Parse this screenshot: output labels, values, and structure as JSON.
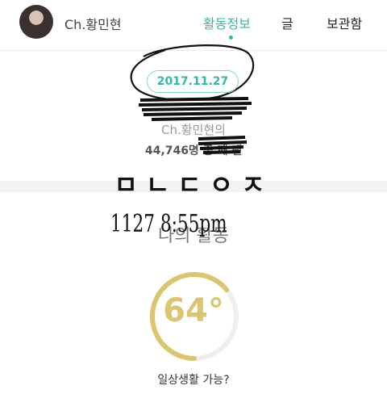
{
  "header": {
    "channel_name": "Ch.황민현",
    "tabs": [
      {
        "label": "활동정보",
        "active": true
      },
      {
        "label": "글",
        "active": false
      },
      {
        "label": "보관함",
        "active": false
      }
    ]
  },
  "profile": {
    "date": "2017.11.27",
    "fan_of": "Ch.황민현의",
    "rank_line": "44,746명 중 째 팬"
  },
  "overlay": {
    "stamp_text": "ㅁㄴㄷㅇㅈ",
    "handwritten_note": "1127 8:55pm"
  },
  "activity": {
    "section_title": "나의 활동",
    "gauge_value": 64,
    "gauge_label": "64°",
    "caption": "일상생활 가능?"
  },
  "colors": {
    "accent": "#2fb9a6",
    "gauge": "#dbc66f"
  }
}
